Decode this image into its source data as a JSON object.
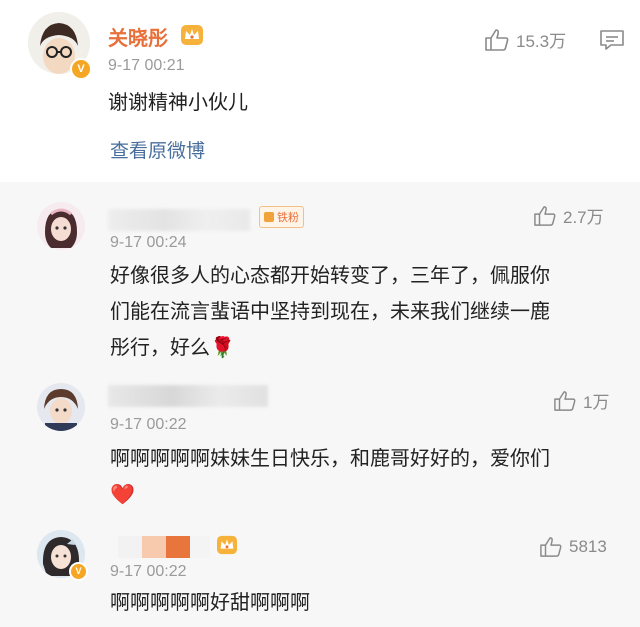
{
  "post": {
    "author": "关晓彤",
    "date": "9-17 00:21",
    "likes": "15.3万",
    "text": "谢谢精神小伙儿",
    "view_original": "查看原微博",
    "icons": [
      "crown-icon",
      "thumbs-up-icon",
      "comment-icon",
      "v-badge-icon"
    ]
  },
  "comments": [
    {
      "badge": "铁粉",
      "date": "9-17 00:24",
      "likes": "2.7万",
      "text_lines": [
        "好像很多人的心态都开始转变了，三年了，佩服你",
        "们能在流言蜚语中坚持到现在，未来我们继续一鹿",
        "彤行，好么🌹"
      ]
    },
    {
      "date": "9-17 00:22",
      "likes": "1万",
      "text_lines": [
        "啊啊啊啊啊妹妹生日快乐，和鹿哥好好的，爱你们",
        "❤️"
      ]
    },
    {
      "date": "9-17 00:22",
      "likes": "5813",
      "text_lines": [
        "啊啊啊啊啊好甜啊啊啊"
      ]
    }
  ],
  "colors": {
    "author_name": "#e8703a",
    "link": "#4a6f9c",
    "date": "#9a9a9a",
    "badge_gold": "#f5a623"
  }
}
